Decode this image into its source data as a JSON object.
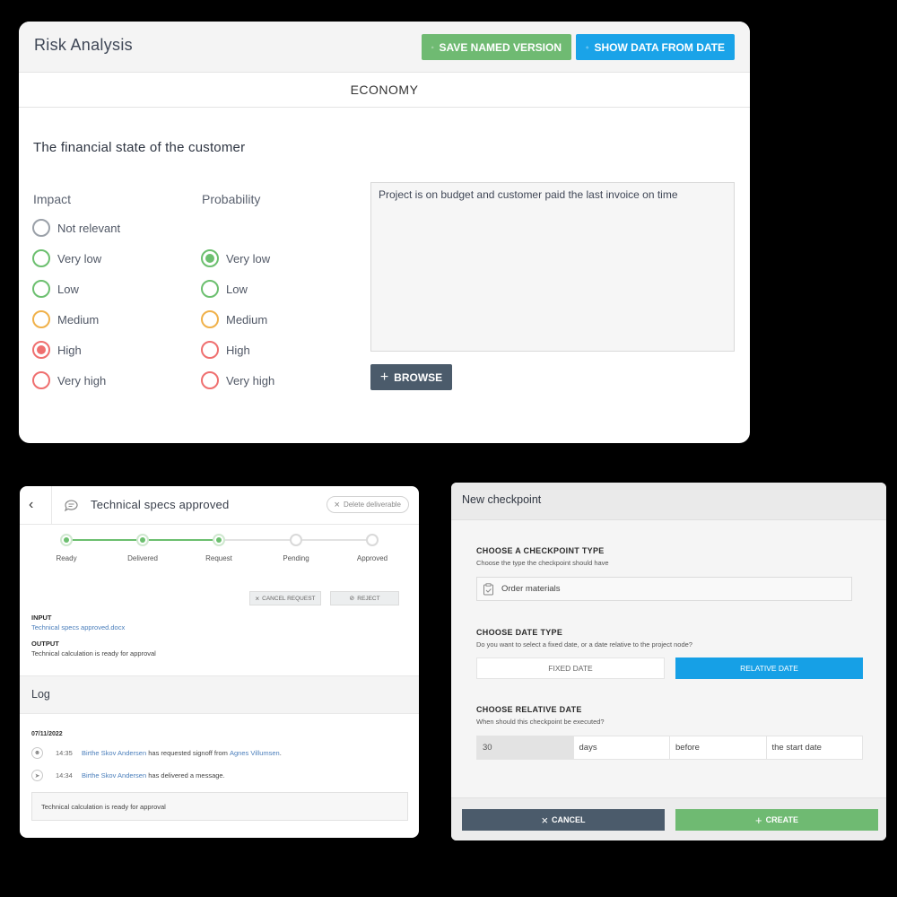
{
  "risk": {
    "title": "Risk Analysis",
    "save_button": "SAVE NAMED VERSION",
    "show_button": "SHOW DATA FROM DATE",
    "section": "ECONOMY",
    "subtitle": "The financial state of the customer",
    "impact_label": "Impact",
    "probability_label": "Probability",
    "impact_options": [
      "Not relevant",
      "Very low",
      "Low",
      "Medium",
      "High",
      "Very high"
    ],
    "impact_selected": "High",
    "probability_options": [
      "Very low",
      "Low",
      "Medium",
      "High",
      "Very high"
    ],
    "probability_selected": "Very low",
    "comment": "Project is on budget and customer paid the last invoice on time",
    "browse_button": "BROWSE",
    "colors": {
      "green": "#6fba72",
      "blue": "#1aa3e8",
      "dark": "#4b5b6b",
      "orange": "#f0b14a",
      "red": "#ef6f6f",
      "grey": "#9aa0a8"
    }
  },
  "deliverable": {
    "title": "Technical specs approved",
    "delete_button": "Delete deliverable",
    "steps": [
      "Ready",
      "Delivered",
      "Request",
      "Pending",
      "Approved"
    ],
    "steps_completed": 3,
    "cancel_request_button": "CANCEL REQUEST",
    "reject_button": "REJECT",
    "input_label": "INPUT",
    "input_value": "Technical specs approved.docx",
    "output_label": "OUTPUT",
    "output_value": "Technical calculation is ready for approval",
    "log_title": "Log",
    "log_date": "07/11/2022",
    "log_entries": [
      {
        "icon": "user-icon",
        "time": "14:35",
        "actor": "Birthe Skov Andersen",
        "text": " has requested signoff from ",
        "target": "Agnes Villumsen",
        "end": "."
      },
      {
        "icon": "send-icon",
        "time": "14:34",
        "actor": "Birthe Skov Andersen",
        "text": " has delivered a message.",
        "target": "",
        "end": ""
      }
    ],
    "log_message": "Technical calculation is ready for approval"
  },
  "checkpoint": {
    "title": "New checkpoint",
    "type_title": "CHOOSE A CHECKPOINT TYPE",
    "type_sub": "Choose the type the checkpoint should have",
    "type_value": "Order materials",
    "date_type_title": "CHOOSE DATE TYPE",
    "date_type_sub": "Do you want to select a fixed date, or a date relative to the project node?",
    "fixed_date": "FIXED DATE",
    "relative_date": "RELATIVE DATE",
    "selected_date_type": "RELATIVE DATE",
    "relative_title": "CHOOSE RELATIVE DATE",
    "relative_sub": "When should this checkpoint be executed?",
    "relative_amount": "30",
    "relative_unit": "days",
    "relative_direction": "before",
    "relative_anchor": "the start date",
    "cancel_button": "CANCEL",
    "create_button": "CREATE"
  }
}
